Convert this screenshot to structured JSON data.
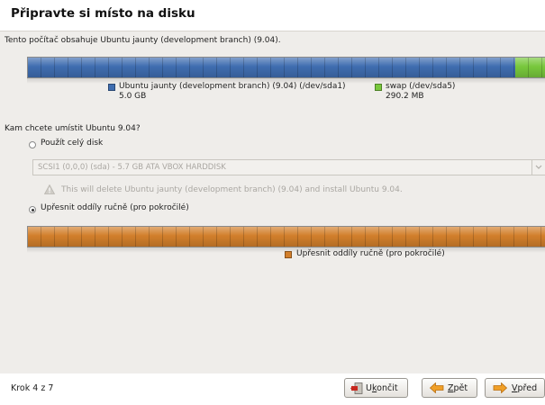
{
  "header": {
    "title": "Připravte si místo na disku"
  },
  "disk_info": "Tento počítač obsahuje Ubuntu jaunty (development branch) (9.04).",
  "partitions": [
    {
      "name": "Ubuntu jaunty (development branch) (9.04) (/dev/sda1)",
      "size": "5.0 GB",
      "color": "#3f6db0"
    },
    {
      "name": "swap (/dev/sda5)",
      "size": "290.2 MB",
      "color": "#78c83c"
    }
  ],
  "question": "Kam chcete umístit Ubuntu 9.04?",
  "options": {
    "whole_disk": {
      "label": "Použít celý disk",
      "selected": false
    },
    "disk_select": {
      "value": "SCSI1 (0,0,0) (sda) - 5.7 GB ATA VBOX HARDDISK"
    },
    "warning": "This will delete Ubuntu jaunty (development branch) (9.04) and install Ubuntu 9.04.",
    "manual": {
      "label": "Upřesnit oddíly ručně (pro pokročilé)",
      "selected": true
    }
  },
  "manual_bar": {
    "legend": "Upřesnit oddíly ručně (pro pokročilé)",
    "color": "#d27f2b"
  },
  "footer": {
    "step": "Krok 4 z 7",
    "quit_button": {
      "pre": "U",
      "accel": "k",
      "post": "ončit"
    },
    "back_button": {
      "pre": "",
      "accel": "Z",
      "post": "pět"
    },
    "forward_button": {
      "pre": "",
      "accel": "V",
      "post": "před"
    }
  }
}
